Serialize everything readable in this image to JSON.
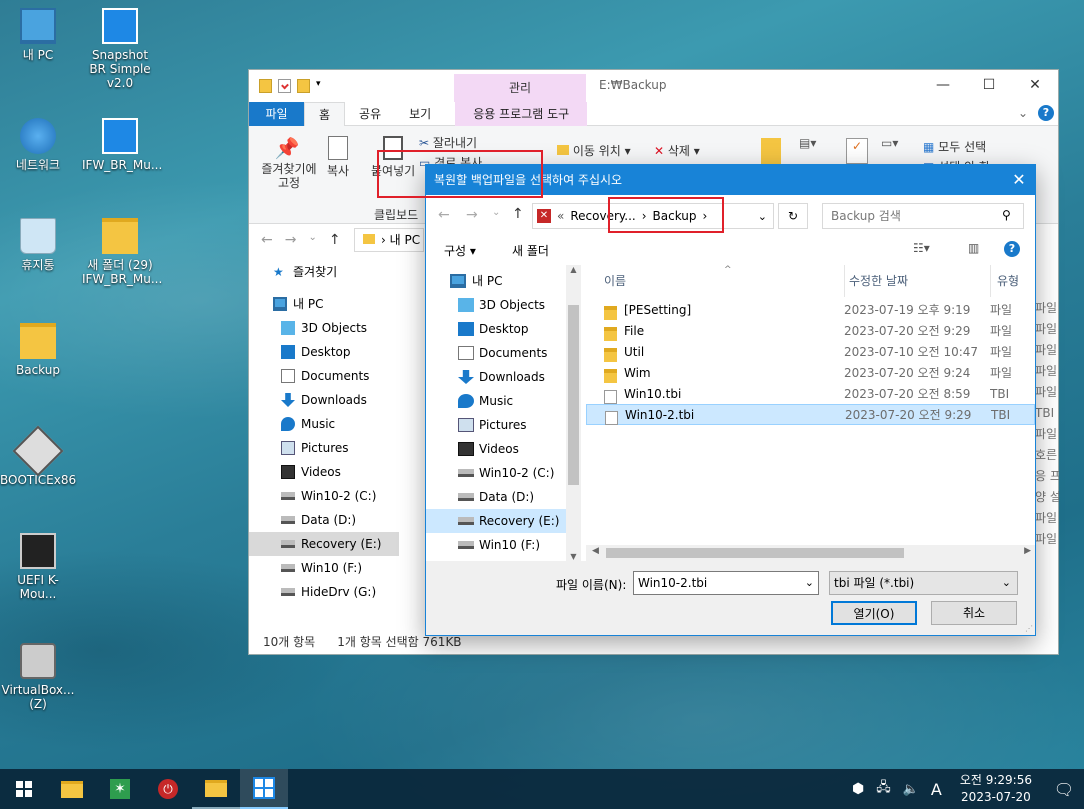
{
  "desktop_icons": [
    {
      "label": "내 PC",
      "icon": "pc-icon"
    },
    {
      "label": "Snapshot BR Simple v2.0",
      "icon": "windows-shield-icon"
    },
    {
      "label": "네트워크",
      "icon": "network-icon"
    },
    {
      "label": "IFW_BR_Mu...",
      "icon": "windows-shield-icon"
    },
    {
      "label": "휴지통",
      "icon": "recycle-bin-icon"
    },
    {
      "label": "새 폴더 (29) IFW_BR_Mu...",
      "icon": "folder-icon"
    },
    {
      "label": "Backup",
      "icon": "folder-icon"
    },
    {
      "label": "BOOTICEx86",
      "icon": "bootice-icon"
    },
    {
      "label": "UEFI K-Mou...",
      "icon": "k-icon"
    },
    {
      "label": "VirtualBox... (Z)",
      "icon": "network-drive-icon"
    }
  ],
  "explorer": {
    "context_tab": "관리",
    "title": "E:₩Backup",
    "tabs": [
      "파일",
      "홈",
      "공유",
      "보기",
      "응용 프로그램 도구"
    ],
    "ribbon": {
      "pin": "즐겨찾기에 고정",
      "copy": "복사",
      "paste": "붙여넣기",
      "cut": "잘라내기",
      "copy_path": "경로 복사",
      "clipboard_group": "클립보드",
      "move_to": "이동 위치",
      "delete": "삭제",
      "select_all": "모두 선택",
      "select_none": "선택 안 함"
    },
    "address": "내 PC",
    "tree": [
      {
        "label": "즐겨찾기",
        "icon": "star-icon"
      },
      {
        "label": "내 PC",
        "icon": "pc-icon"
      },
      {
        "label": "3D Objects",
        "icon": "3d-objects-icon"
      },
      {
        "label": "Desktop",
        "icon": "desktop-icon"
      },
      {
        "label": "Documents",
        "icon": "documents-icon"
      },
      {
        "label": "Downloads",
        "icon": "downloads-icon"
      },
      {
        "label": "Music",
        "icon": "music-icon"
      },
      {
        "label": "Pictures",
        "icon": "pictures-icon"
      },
      {
        "label": "Videos",
        "icon": "videos-icon"
      },
      {
        "label": "Win10-2 (C:)",
        "icon": "drive-icon"
      },
      {
        "label": "Data (D:)",
        "icon": "drive-icon"
      },
      {
        "label": "Recovery (E:)",
        "icon": "drive-icon"
      },
      {
        "label": "Win10 (F:)",
        "icon": "drive-icon"
      },
      {
        "label": "HideDrv (G:)",
        "icon": "drive-icon"
      }
    ],
    "right_clip": [
      "파일",
      "파일",
      "파일",
      "파일",
      "파일",
      "TBI",
      "파일",
      "호른",
      "응 프",
      "양 설",
      "파일",
      "파일"
    ],
    "status": {
      "count": "10개 항목",
      "selected": "1개 항목 선택함 761KB"
    }
  },
  "dialog": {
    "title": "복원할 백업파일을 선택하여 주십시오",
    "breadcrumb": [
      "Recovery...",
      "Backup"
    ],
    "search_placeholder": "Backup 검색",
    "organize": "구성",
    "new_folder": "새 폴더",
    "tree": [
      {
        "label": "내 PC",
        "icon": "pc-icon"
      },
      {
        "label": "3D Objects",
        "icon": "3d-objects-icon"
      },
      {
        "label": "Desktop",
        "icon": "desktop-icon"
      },
      {
        "label": "Documents",
        "icon": "documents-icon"
      },
      {
        "label": "Downloads",
        "icon": "downloads-icon"
      },
      {
        "label": "Music",
        "icon": "music-icon"
      },
      {
        "label": "Pictures",
        "icon": "pictures-icon"
      },
      {
        "label": "Videos",
        "icon": "videos-icon"
      },
      {
        "label": "Win10-2 (C:)",
        "icon": "drive-icon"
      },
      {
        "label": "Data (D:)",
        "icon": "drive-icon"
      },
      {
        "label": "Recovery (E:)",
        "icon": "drive-icon"
      },
      {
        "label": "Win10 (F:)",
        "icon": "drive-icon"
      }
    ],
    "columns": {
      "name": "이름",
      "date": "수정한 날짜",
      "type": "유형"
    },
    "files": [
      {
        "name": "[PESetting]",
        "date": "2023-07-19 오후 9:19",
        "type": "파일",
        "icon": "folder-icon"
      },
      {
        "name": "File",
        "date": "2023-07-20 오전 9:29",
        "type": "파일",
        "icon": "folder-icon"
      },
      {
        "name": "Util",
        "date": "2023-07-10 오전 10:47",
        "type": "파일",
        "icon": "folder-icon"
      },
      {
        "name": "Wim",
        "date": "2023-07-20 오전 9:24",
        "type": "파일",
        "icon": "folder-icon"
      },
      {
        "name": "Win10.tbi",
        "date": "2023-07-20 오전 8:59",
        "type": "TBI",
        "icon": "file-icon"
      },
      {
        "name": "Win10-2.tbi",
        "date": "2023-07-20 오전 9:29",
        "type": "TBI",
        "icon": "file-icon"
      }
    ],
    "filename_label": "파일 이름(N):",
    "filename_value": "Win10-2.tbi",
    "filter": "tbi 파일 (*.tbi)",
    "open": "열기(O)",
    "cancel": "취소"
  },
  "taskbar": {
    "time": "오전 9:29:56",
    "date": "2023-07-20",
    "ime": "A"
  }
}
